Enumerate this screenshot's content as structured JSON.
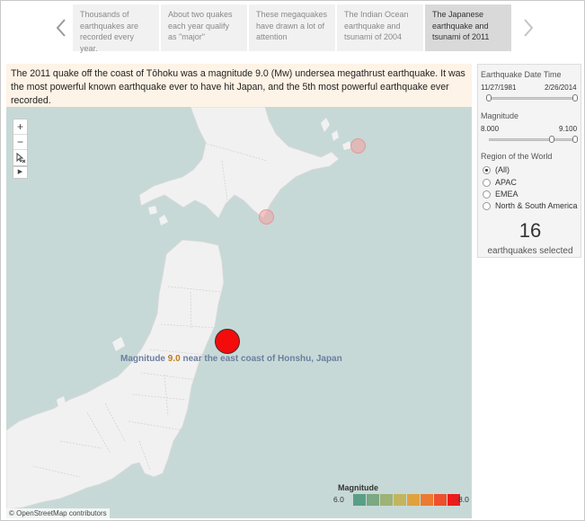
{
  "story": {
    "points": [
      {
        "text": "Thousands of earthquakes are recorded every year."
      },
      {
        "text": "About two quakes each year qualify as \"major\""
      },
      {
        "text": "These megaquakes have drawn a lot of attention"
      },
      {
        "text": "The Indian Ocean earthquake and tsunami of 2004"
      },
      {
        "text": "The Japanese earthquake and tsunami of 2011"
      }
    ],
    "active_index": 4
  },
  "caption": "The 2011 quake off the coast of Tōhoku was a magnitude 9.0 (Mw) undersea megathrust earthquake. It was the most powerful known earthquake ever to have hit Japan, and the 5th most powerful earthquake ever recorded.",
  "map": {
    "zoom_in": "+",
    "zoom_out": "−",
    "label": {
      "prefix": "Magnitude ",
      "magnitude": "9.0",
      "suffix": " near the east coast of Honshu, Japan"
    },
    "attribution": "© OpenStreetMap contributors",
    "legend": {
      "title": "Magnitude",
      "min": "6.0",
      "max": "8.0",
      "colors": [
        "#5b9e87",
        "#7aa882",
        "#9db377",
        "#c2b55d",
        "#e0a23f",
        "#ec7a31",
        "#ef4f2c",
        "#ea1d1d"
      ]
    },
    "colors": {
      "water": "#c7d9d7",
      "land": "#f1f1f1",
      "quake_major": "#f40b0b"
    }
  },
  "filters": {
    "date": {
      "title": "Earthquake Date Time",
      "min": "11/27/1981",
      "max": "2/26/2014"
    },
    "magnitude": {
      "title": "Magnitude",
      "min": "8.000",
      "max": "9.100"
    },
    "region": {
      "title": "Region of the World",
      "options": [
        "(All)",
        "APAC",
        "EMEA",
        "North & South America"
      ],
      "selected": "(All)"
    },
    "count": "16",
    "count_label": "earthquakes selected"
  }
}
